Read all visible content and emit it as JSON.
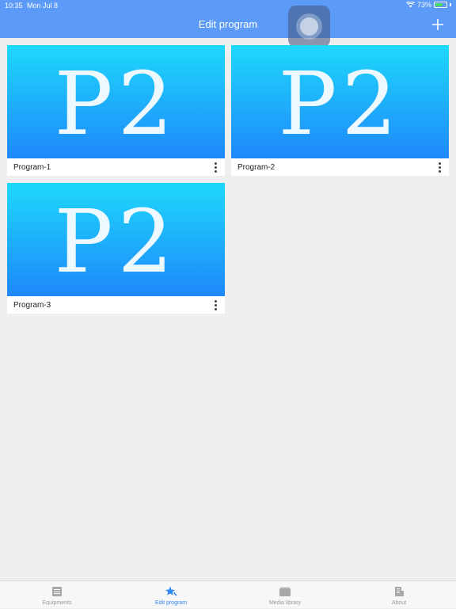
{
  "status_bar": {
    "time": "10:35",
    "date": "Mon Jul 8",
    "battery": "73%",
    "battery_level": 0.73
  },
  "header": {
    "title": "Edit program",
    "add_icon": "plus-icon",
    "background_color": "#5b9bf7"
  },
  "programs": [
    {
      "name": "Program-1",
      "thumbnail_text": "P2"
    },
    {
      "name": "Program-2",
      "thumbnail_text": "P2"
    },
    {
      "name": "Program-3",
      "thumbnail_text": "P2"
    }
  ],
  "tabs": [
    {
      "label": "Equipments",
      "icon": "list-icon",
      "active": false
    },
    {
      "label": "Edit program",
      "icon": "star-edit-icon",
      "active": true
    },
    {
      "label": "Media library",
      "icon": "folder-icon",
      "active": false
    },
    {
      "label": "About",
      "icon": "building-icon",
      "active": false
    }
  ],
  "colors": {
    "accent": "#2f86f6",
    "inactive_tab": "#9a9a9a",
    "thumbnail_top": "#1ed8fb",
    "thumbnail_bottom": "#1e88fb"
  }
}
